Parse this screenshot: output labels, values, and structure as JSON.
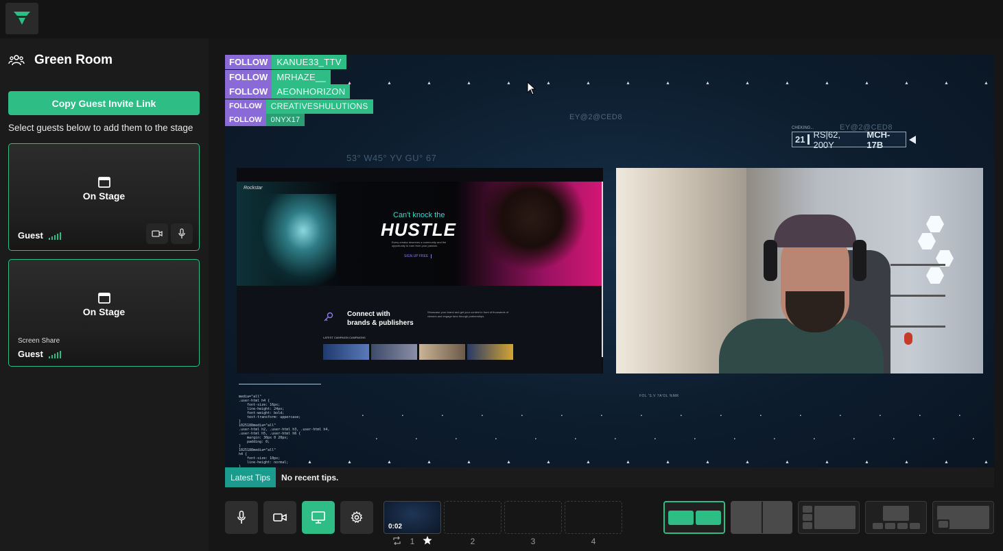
{
  "green_room": {
    "title": "Green Room",
    "copy_invite_label": "Copy Guest Invite Link",
    "hint": "Select guests below to add them to the stage",
    "guests": [
      {
        "status": "On Stage",
        "name": "Guest",
        "sublabel": ""
      },
      {
        "status": "On Stage",
        "name": "Guest",
        "sublabel": "Screen Share"
      }
    ]
  },
  "stage": {
    "follow_tag": "FOLLOW",
    "followers": [
      "KANUE33_TTV",
      "MRHAZE__",
      "AEONHORIZON",
      "CREATIVESHULUTIONS",
      "0NYX17"
    ],
    "hud": {
      "top_text": "EY@2@CED8",
      "right_text": "EY@2@CED8",
      "coords_text": "53° W45° YV GU° 67",
      "checking": "CHEKING...",
      "box_num": "21",
      "box_text": "RS|62, 200Y",
      "box_code": "MCH-17B",
      "small_right": "FOL 'S.V 7A'OL %MR"
    },
    "screen_share": {
      "logo": "Rockstar",
      "hero_small": "Can't knock the",
      "hero_big": "HUSTLE",
      "hero_sub": "Every creator deserves a community and the opportunity to earn from your passion.",
      "cta": "SIGN UP FREE",
      "connect_line1": "Connect with",
      "connect_line2": "brands & publishers",
      "connect_body": "Showcase your brand and get your content in front of thousands of viewers and engage fans through partnerships.",
      "campaigns_label": "LATEST CAMPAIGN CAMPAIGNS"
    },
    "code": "media=\"all\"\n.user-html h4 {\n    font-size: 16px;\n    line-height: 24px;\n    font-weight: bold;\n    text-transform: uppercase;\n}\n1025188media=\"all\"\n.user-html h2, .user-html h3, .user-html h4,\n.user-html h5, .user-html h6 {\n    margin: 30px 0 20px;\n    padding: 0;\n}\n1025188media=\"all\"\nh4 {\n    font-size: 10px;\n    line-height: normal;\n}"
  },
  "tips": {
    "label": "Latest Tips",
    "text": "No recent tips."
  },
  "controls": {
    "icons": [
      "mic-icon",
      "camera-icon",
      "screen-share-icon",
      "gear-icon"
    ]
  },
  "scenes": {
    "items": [
      {
        "number": "1",
        "time": "0:02"
      },
      {
        "number": "2",
        "time": ""
      },
      {
        "number": "3",
        "time": ""
      },
      {
        "number": "4",
        "time": ""
      }
    ]
  },
  "colors": {
    "accent": "#2ebd85",
    "follow_purple": "#8a6ad6",
    "tips_teal": "#1d9a8e"
  }
}
